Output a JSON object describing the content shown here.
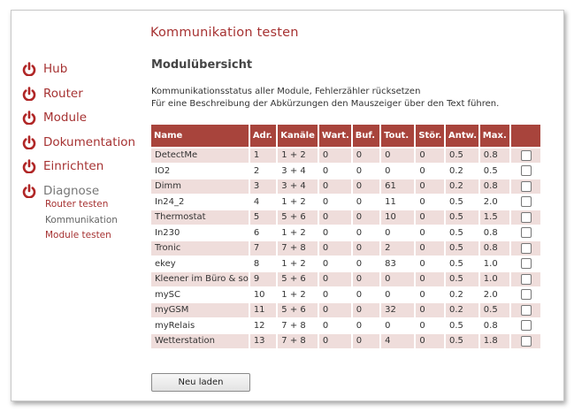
{
  "header": {
    "title": "Kommunikation testen"
  },
  "nav": {
    "items": [
      {
        "label": "Hub"
      },
      {
        "label": "Router"
      },
      {
        "label": "Module"
      },
      {
        "label": "Dokumentation"
      },
      {
        "label": "Einrichten"
      },
      {
        "label": "Diagnose"
      }
    ],
    "sub_items": [
      {
        "label": "Router testen"
      },
      {
        "label": "Kommunikation"
      },
      {
        "label": "Module testen"
      }
    ]
  },
  "main": {
    "section_title": "Modulübersicht",
    "desc_line1": "Kommunikationsstatus aller Module, Fehlerzähler rücksetzen",
    "desc_line2": "Für eine Beschreibung der Abkürzungen den Mauszeiger über den Text führen.",
    "table": {
      "headers": [
        "Name",
        "Adr.",
        "Kanäle",
        "Wart.",
        "Buf.",
        "Tout.",
        "Stör.",
        "Antw.",
        "Max.",
        ""
      ],
      "rows": [
        [
          "DetectMe",
          "1",
          "1 + 2",
          "0",
          "0",
          "0",
          "0",
          "0.5",
          "0.8"
        ],
        [
          "IO2",
          "2",
          "3 + 4",
          "0",
          "0",
          "0",
          "0",
          "0.2",
          "0.5"
        ],
        [
          "Dimm",
          "3",
          "3 + 4",
          "0",
          "0",
          "61",
          "0",
          "0.2",
          "0.8"
        ],
        [
          "In24_2",
          "4",
          "1 + 2",
          "0",
          "0",
          "11",
          "0",
          "0.5",
          "2.0"
        ],
        [
          "Thermostat",
          "5",
          "5 + 6",
          "0",
          "0",
          "10",
          "0",
          "0.5",
          "1.5"
        ],
        [
          "In230",
          "6",
          "1 + 2",
          "0",
          "0",
          "0",
          "0",
          "0.5",
          "0.8"
        ],
        [
          "Tronic",
          "7",
          "7 + 8",
          "0",
          "0",
          "2",
          "0",
          "0.5",
          "0.8"
        ],
        [
          "ekey",
          "8",
          "1 + 2",
          "0",
          "0",
          "83",
          "0",
          "0.5",
          "1.0"
        ],
        [
          "Kleener im Büro & so",
          "9",
          "5 + 6",
          "0",
          "0",
          "0",
          "0",
          "0.5",
          "1.0"
        ],
        [
          "mySC",
          "10",
          "1 + 2",
          "0",
          "0",
          "0",
          "0",
          "0.2",
          "2.0"
        ],
        [
          "myGSM",
          "11",
          "5 + 6",
          "0",
          "0",
          "32",
          "0",
          "0.2",
          "0.5"
        ],
        [
          "myRelais",
          "12",
          "7 + 8",
          "0",
          "0",
          "0",
          "0",
          "0.5",
          "0.8"
        ],
        [
          "Wetterstation",
          "13",
          "7 + 8",
          "0",
          "0",
          "4",
          "0",
          "0.5",
          "1.8"
        ]
      ]
    },
    "reload_button": "Neu laden"
  },
  "colors": {
    "accent": "#a63232",
    "header_bg": "#a8443c",
    "row_alt": "#efdddb"
  }
}
